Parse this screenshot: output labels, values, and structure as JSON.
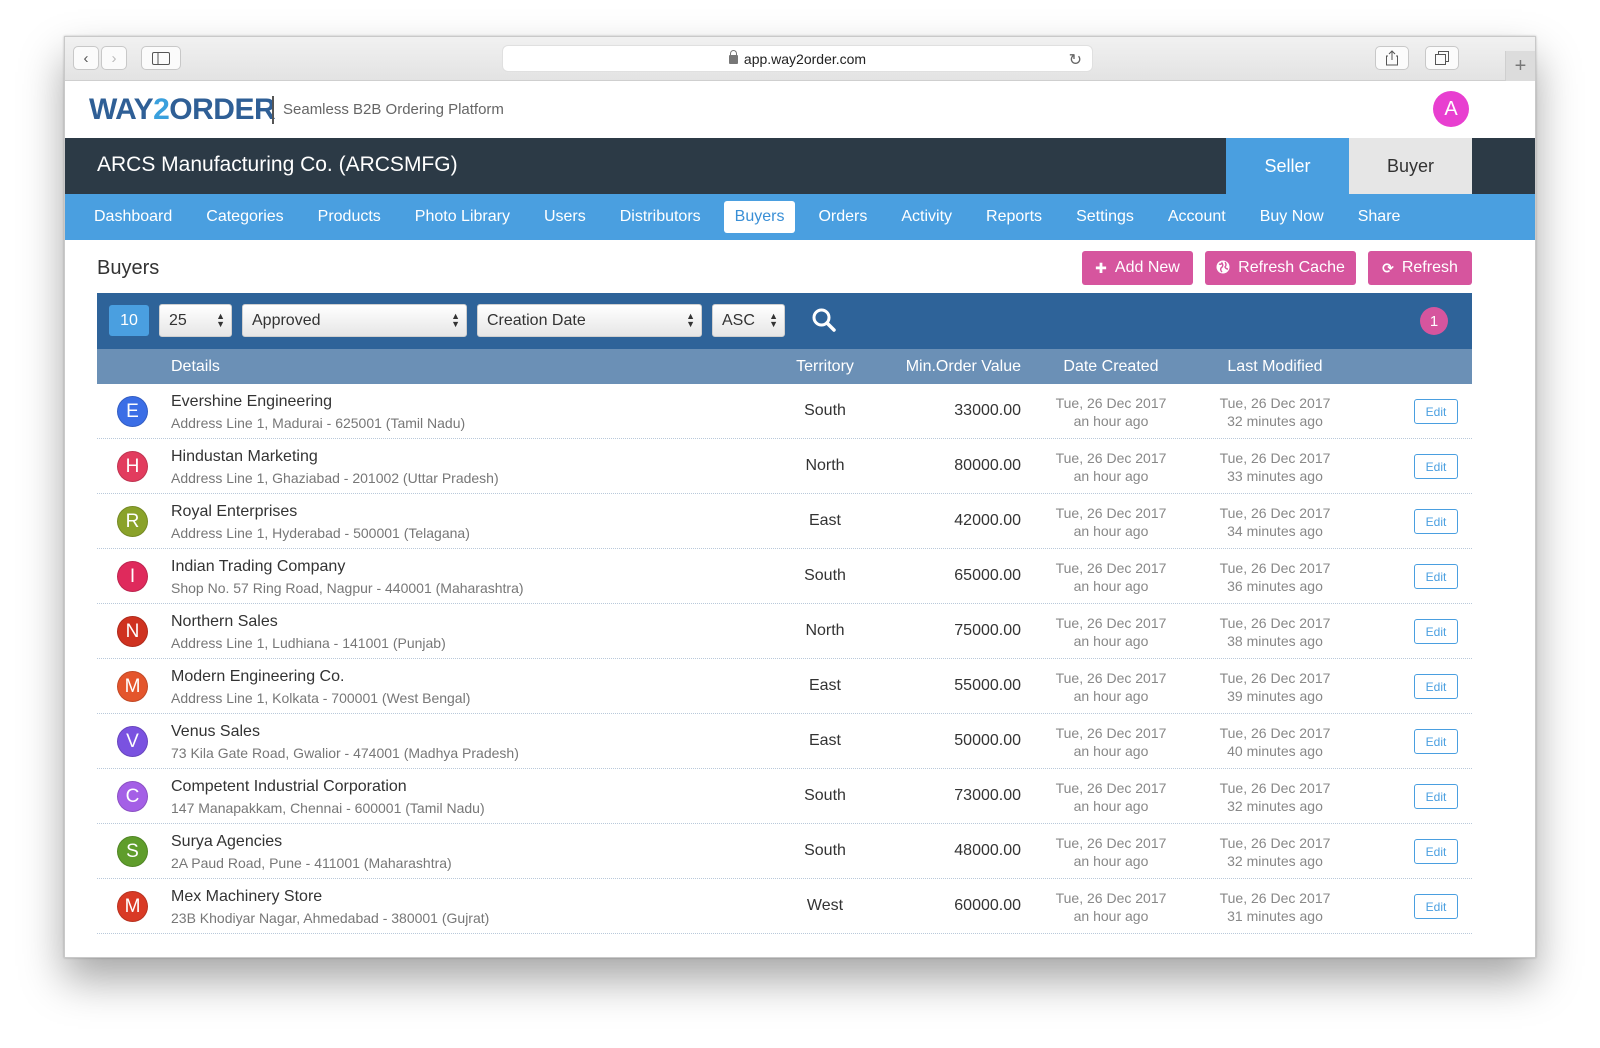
{
  "browser": {
    "url": "app.way2order.com"
  },
  "header": {
    "logo_main": "WAY",
    "logo_two": "2",
    "logo_rest": "ORDER",
    "tagline": "Seamless B2B Ordering Platform",
    "user_initial": "A"
  },
  "company": {
    "name": "ARCS Manufacturing Co. (ARCSMFG)",
    "seller_label": "Seller",
    "buyer_label": "Buyer"
  },
  "nav": {
    "items": [
      "Dashboard",
      "Categories",
      "Products",
      "Photo Library",
      "Users",
      "Distributors",
      "Buyers",
      "Orders",
      "Activity",
      "Reports",
      "Settings",
      "Account",
      "Buy Now",
      "Share"
    ],
    "active": "Buyers"
  },
  "page": {
    "title": "Buyers",
    "add_new": "Add New",
    "refresh_cache": "Refresh Cache",
    "refresh": "Refresh"
  },
  "filters": {
    "count": "10",
    "per_page": "25",
    "status": "Approved",
    "sort_by": "Creation Date",
    "order": "ASC",
    "page": "1"
  },
  "table": {
    "columns": [
      "Details",
      "Territory",
      "Min.Order Value",
      "Date Created",
      "Last Modified"
    ],
    "edit_label": "Edit",
    "rows": [
      {
        "initial": "E",
        "color": "#3b6ee6",
        "name": "Evershine Engineering",
        "address": "Address Line 1, Madurai - 625001 (Tamil Nadu)",
        "territory": "South",
        "min_order": "33000.00",
        "created_date": "Tue, 26 Dec 2017",
        "created_ago": "an hour ago",
        "modified_date": "Tue, 26 Dec 2017",
        "modified_ago": "32 minutes ago"
      },
      {
        "initial": "H",
        "color": "#e23c5e",
        "name": "Hindustan Marketing",
        "address": "Address Line 1, Ghaziabad - 201002 (Uttar Pradesh)",
        "territory": "North",
        "min_order": "80000.00",
        "created_date": "Tue, 26 Dec 2017",
        "created_ago": "an hour ago",
        "modified_date": "Tue, 26 Dec 2017",
        "modified_ago": "33 minutes ago"
      },
      {
        "initial": "R",
        "color": "#8aa22a",
        "name": "Royal Enterprises",
        "address": "Address Line 1, Hyderabad - 500001 (Telagana)",
        "territory": "East",
        "min_order": "42000.00",
        "created_date": "Tue, 26 Dec 2017",
        "created_ago": "an hour ago",
        "modified_date": "Tue, 26 Dec 2017",
        "modified_ago": "34 minutes ago"
      },
      {
        "initial": "I",
        "color": "#df2a5c",
        "name": "Indian Trading Company",
        "address": "Shop No. 57 Ring Road, Nagpur - 440001 (Maharashtra)",
        "territory": "South",
        "min_order": "65000.00",
        "created_date": "Tue, 26 Dec 2017",
        "created_ago": "an hour ago",
        "modified_date": "Tue, 26 Dec 2017",
        "modified_ago": "36 minutes ago"
      },
      {
        "initial": "N",
        "color": "#cf3220",
        "name": "Northern Sales",
        "address": "Address Line 1, Ludhiana - 141001 (Punjab)",
        "territory": "North",
        "min_order": "75000.00",
        "created_date": "Tue, 26 Dec 2017",
        "created_ago": "an hour ago",
        "modified_date": "Tue, 26 Dec 2017",
        "modified_ago": "38 minutes ago"
      },
      {
        "initial": "M",
        "color": "#e4552c",
        "name": "Modern Engineering Co.",
        "address": "Address Line 1, Kolkata - 700001 (West Bengal)",
        "territory": "East",
        "min_order": "55000.00",
        "created_date": "Tue, 26 Dec 2017",
        "created_ago": "an hour ago",
        "modified_date": "Tue, 26 Dec 2017",
        "modified_ago": "39 minutes ago"
      },
      {
        "initial": "V",
        "color": "#7a52e0",
        "name": "Venus Sales",
        "address": "73 Kila Gate Road, Gwalior - 474001 (Madhya Pradesh)",
        "territory": "East",
        "min_order": "50000.00",
        "created_date": "Tue, 26 Dec 2017",
        "created_ago": "an hour ago",
        "modified_date": "Tue, 26 Dec 2017",
        "modified_ago": "40 minutes ago"
      },
      {
        "initial": "C",
        "color": "#a45fe6",
        "name": "Competent Industrial Corporation",
        "address": "147 Manapakkam, Chennai - 600001 (Tamil Nadu)",
        "territory": "South",
        "min_order": "73000.00",
        "created_date": "Tue, 26 Dec 2017",
        "created_ago": "an hour ago",
        "modified_date": "Tue, 26 Dec 2017",
        "modified_ago": "32 minutes ago"
      },
      {
        "initial": "S",
        "color": "#5f9d2b",
        "name": "Surya Agencies",
        "address": "2A Paud Road, Pune - 411001 (Maharashtra)",
        "territory": "South",
        "min_order": "48000.00",
        "created_date": "Tue, 26 Dec 2017",
        "created_ago": "an hour ago",
        "modified_date": "Tue, 26 Dec 2017",
        "modified_ago": "32 minutes ago"
      },
      {
        "initial": "M",
        "color": "#d93a25",
        "name": "Mex Machinery Store",
        "address": "23B Khodiyar Nagar, Ahmedabad - 380001 (Gujrat)",
        "territory": "West",
        "min_order": "60000.00",
        "created_date": "Tue, 26 Dec 2017",
        "created_ago": "an hour ago",
        "modified_date": "Tue, 26 Dec 2017",
        "modified_ago": "31 minutes ago"
      }
    ]
  },
  "colors": {
    "brand_blue": "#4a9fe0",
    "dark_bar": "#2c3a46",
    "accent_pink": "#d6559e",
    "filter_bar": "#2e6399"
  }
}
